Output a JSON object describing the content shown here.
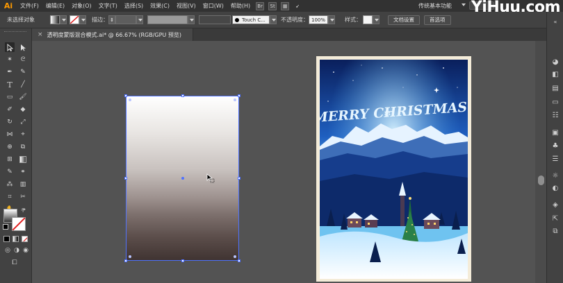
{
  "app": {
    "logo": "Ai"
  },
  "menu": {
    "items": [
      "文件(F)",
      "编辑(E)",
      "对象(O)",
      "文字(T)",
      "选择(S)",
      "效果(C)",
      "视图(V)",
      "窗口(W)",
      "帮助(H)"
    ],
    "badges": [
      "Br",
      "St"
    ],
    "workspace": "传统基本功能",
    "watermark": "YiHuu.com"
  },
  "control": {
    "no_selection": "未选择对象",
    "stroke_label": "描边：",
    "brush_name": "Touch C...",
    "opacity_label": "不透明度：",
    "opacity_value": "100%",
    "style_label": "样式：",
    "doc_settings": "文档设置",
    "preferences": "首选项"
  },
  "document": {
    "tab_title": "透明度蒙版混合模式.ai* @ 66.67% (RGB/GPU 预览)",
    "close_glyph": "×"
  },
  "artwork": {
    "greeting": "MERRY CHRISTMAS!"
  },
  "colors": {
    "menubar": "#323232",
    "panel": "#424242",
    "canvas": "#535353",
    "selection": "#4f72ff",
    "accent_logo": "#ff9a00"
  },
  "icons": {
    "toolbar": [
      "selection-icon",
      "direct-selection-icon",
      "magic-wand-icon",
      "lasso-icon",
      "pen-icon",
      "curvature-icon",
      "type-icon",
      "line-icon",
      "rectangle-icon",
      "paintbrush-icon",
      "shaper-icon",
      "eraser-icon",
      "rotate-icon",
      "scale-icon",
      "width-icon",
      "free-transform-icon",
      "shape-builder-icon",
      "perspective-icon",
      "mesh-icon",
      "gradient-icon",
      "eyedropper-icon",
      "blend-icon",
      "symbol-sprayer-icon",
      "column-graph-icon",
      "artboard-icon",
      "slice-icon",
      "hand-icon",
      "zoom-icon"
    ],
    "right_panel": [
      "color-icon",
      "color-guide-icon",
      "swatches-icon",
      "brushes-icon",
      "symbols-icon",
      "graphic-styles-icon",
      "stroke-icon",
      "gradient-panel-icon",
      "transparency-icon",
      "appearance-icon",
      "layers-icon",
      "asset-export-icon",
      "artboards-icon"
    ]
  }
}
